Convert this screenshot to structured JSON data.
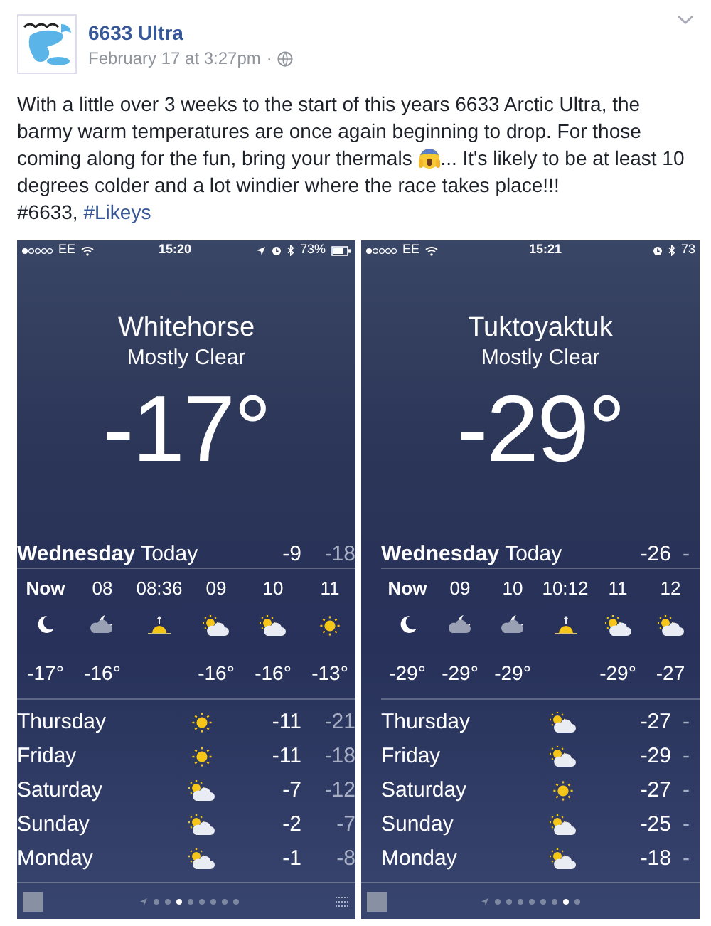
{
  "post": {
    "author": "6633 Ultra",
    "timestamp": "February 17 at 3:27pm",
    "separator": "·",
    "text_parts": [
      "With a little over 3 weeks to the start of this years 6633 Arctic Ultra, the barmy warm temperatures are once again beginning to drop. For those coming along for the fun, bring your thermals",
      "... It's likely to be at least 10 degrees colder and a lot windier where the race takes place!!!"
    ],
    "tags": [
      {
        "text": "#6633,",
        "kind": "plain"
      },
      {
        "text": "#Likeys",
        "kind": "link"
      }
    ]
  },
  "phones": [
    {
      "status": {
        "carrier": "EE",
        "time": "15:20",
        "battery": "73%",
        "location": true,
        "battery_icon": true
      },
      "city": "Whitehorse",
      "condition": "Mostly Clear",
      "temperature": "-17°",
      "today": {
        "day": "Wednesday",
        "label": "Today",
        "high": "-9",
        "low": "-18"
      },
      "hours": [
        {
          "time": "Now",
          "kind": "moon",
          "temp": "-17°"
        },
        {
          "time": "08",
          "kind": "cloud-moon",
          "temp": "-16°"
        },
        {
          "time": "08:36",
          "kind": "sunrise"
        },
        {
          "time": "09",
          "kind": "sun-cloud",
          "temp": "-16°"
        },
        {
          "time": "10",
          "kind": "sun-cloud",
          "temp": "-16°"
        },
        {
          "time": "11",
          "kind": "sun",
          "temp": "-13°"
        }
      ],
      "days": [
        {
          "day": "Thursday",
          "kind": "sun",
          "high": "-11",
          "low": "-21"
        },
        {
          "day": "Friday",
          "kind": "sun",
          "high": "-11",
          "low": "-18"
        },
        {
          "day": "Saturday",
          "kind": "sun-cloud",
          "high": "-7",
          "low": "-12"
        },
        {
          "day": "Sunday",
          "kind": "sun-cloud",
          "high": "-2",
          "low": "-7"
        },
        {
          "day": "Monday",
          "kind": "sun-cloud",
          "high": "-1",
          "low": "-8"
        }
      ],
      "dots": [
        {
          "selected": false
        },
        {
          "selected": false
        },
        {
          "selected": true
        },
        {
          "selected": false
        },
        {
          "selected": false
        },
        {
          "selected": false
        },
        {
          "selected": false
        },
        {
          "selected": false
        }
      ],
      "list_button": true
    },
    {
      "status": {
        "carrier": "EE",
        "time": "15:21",
        "battery": "73",
        "location": false,
        "battery_icon": false
      },
      "city": "Tuktoyaktuk",
      "condition": "Mostly Clear",
      "temperature": "-29°",
      "today": {
        "day": "Wednesday",
        "label": "Today",
        "high": "-26",
        "low": "-"
      },
      "hours": [
        {
          "time": "Now",
          "kind": "moon",
          "temp": "-29°"
        },
        {
          "time": "09",
          "kind": "cloud-moon",
          "temp": "-29°"
        },
        {
          "time": "10",
          "kind": "cloud-moon",
          "temp": "-29°"
        },
        {
          "time": "10:12",
          "kind": "sunrise"
        },
        {
          "time": "11",
          "kind": "sun-cloud",
          "temp": "-29°"
        },
        {
          "time": "12",
          "kind": "sun-cloud",
          "temp": "-27"
        }
      ],
      "days": [
        {
          "day": "Thursday",
          "kind": "sun-cloud",
          "high": "-27",
          "low": "-"
        },
        {
          "day": "Friday",
          "kind": "sun-cloud",
          "high": "-29",
          "low": "-"
        },
        {
          "day": "Saturday",
          "kind": "sun",
          "high": "-27",
          "low": "-"
        },
        {
          "day": "Sunday",
          "kind": "sun-cloud",
          "high": "-25",
          "low": "-"
        },
        {
          "day": "Monday",
          "kind": "sun-cloud",
          "high": "-18",
          "low": "-"
        }
      ],
      "dots": [
        {
          "selected": false
        },
        {
          "selected": false
        },
        {
          "selected": false
        },
        {
          "selected": false
        },
        {
          "selected": false
        },
        {
          "selected": false
        },
        {
          "selected": true
        },
        {
          "selected": false
        }
      ],
      "list_button": false
    }
  ]
}
